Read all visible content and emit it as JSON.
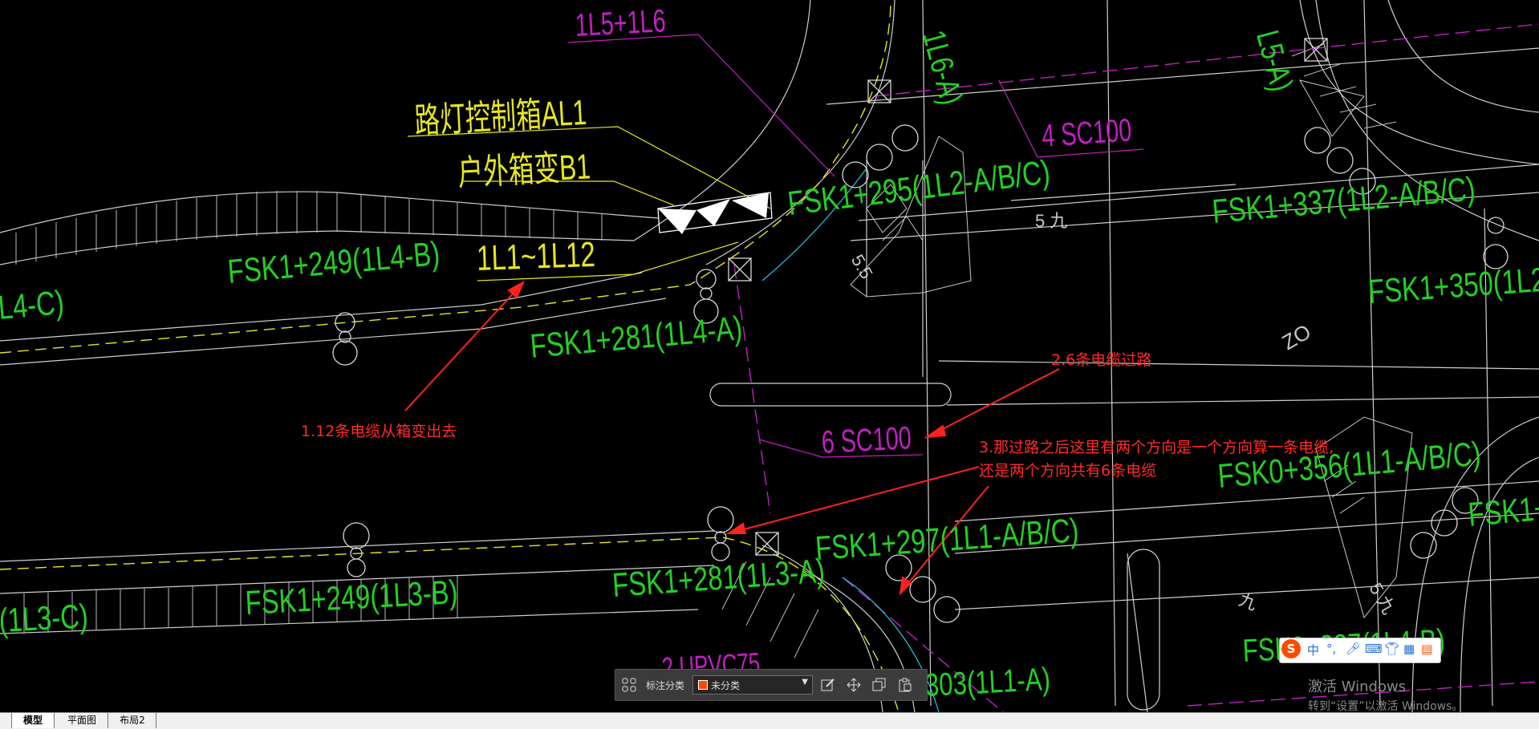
{
  "drawing": {
    "labels_green": [
      "FSK1+295(1L2-A/B/C)",
      "FSK1+337(1L2-A/B/C)",
      "FSK1+350(1L2",
      "FSK1+249(1L4-B)",
      "FSK1+281(1L4-A)",
      "L4-C)",
      "FSK0+356(1L1-A/B/C)",
      "FSK1+",
      "FSK1+297(1L1-A/B/C)",
      "FSK1+281(1L3-A)",
      "FSK1+249(1L3-B)",
      "(1L3-C)",
      "1L6-A)",
      "L5-A)",
      "FSK0+337(1L4-B)",
      "FSK0+303(1L1-A)"
    ],
    "labels_yellow": [
      "路灯控制箱AL1",
      "户外箱变B1",
      "1L1~1L12"
    ],
    "labels_magenta": [
      "1L5+1L6",
      "4 SC100",
      "6 SC100",
      "2 UPVC75"
    ],
    "annotations": [
      "1.12条电缆从箱变出去",
      "2.6条电缆过路",
      "3.那过路之后这里有两个方向是一个方向算一条电缆,",
      "还是两个方向共有6条电缆"
    ],
    "misc_text": [
      "5.5",
      "ZO",
      "九",
      "5 九",
      "5 九"
    ]
  },
  "toolbar": {
    "classify_label": "标注分类",
    "category_value": "未分类",
    "category_color": "#ff4a00"
  },
  "tabs": [
    "模型",
    "平面图",
    "布局2"
  ],
  "active_tab": "模型",
  "ime": {
    "logo": "S",
    "mode": "中"
  },
  "watermark": {
    "line1": "激活 Windows",
    "line2": "转到“设置”以激活 Windows。"
  },
  "colors": {
    "green": "#23d023",
    "yellow": "#e6e620",
    "magenta": "#c21fc2",
    "white": "#d8d8d8",
    "red": "#ff2020",
    "cyan": "#20c8e6"
  }
}
